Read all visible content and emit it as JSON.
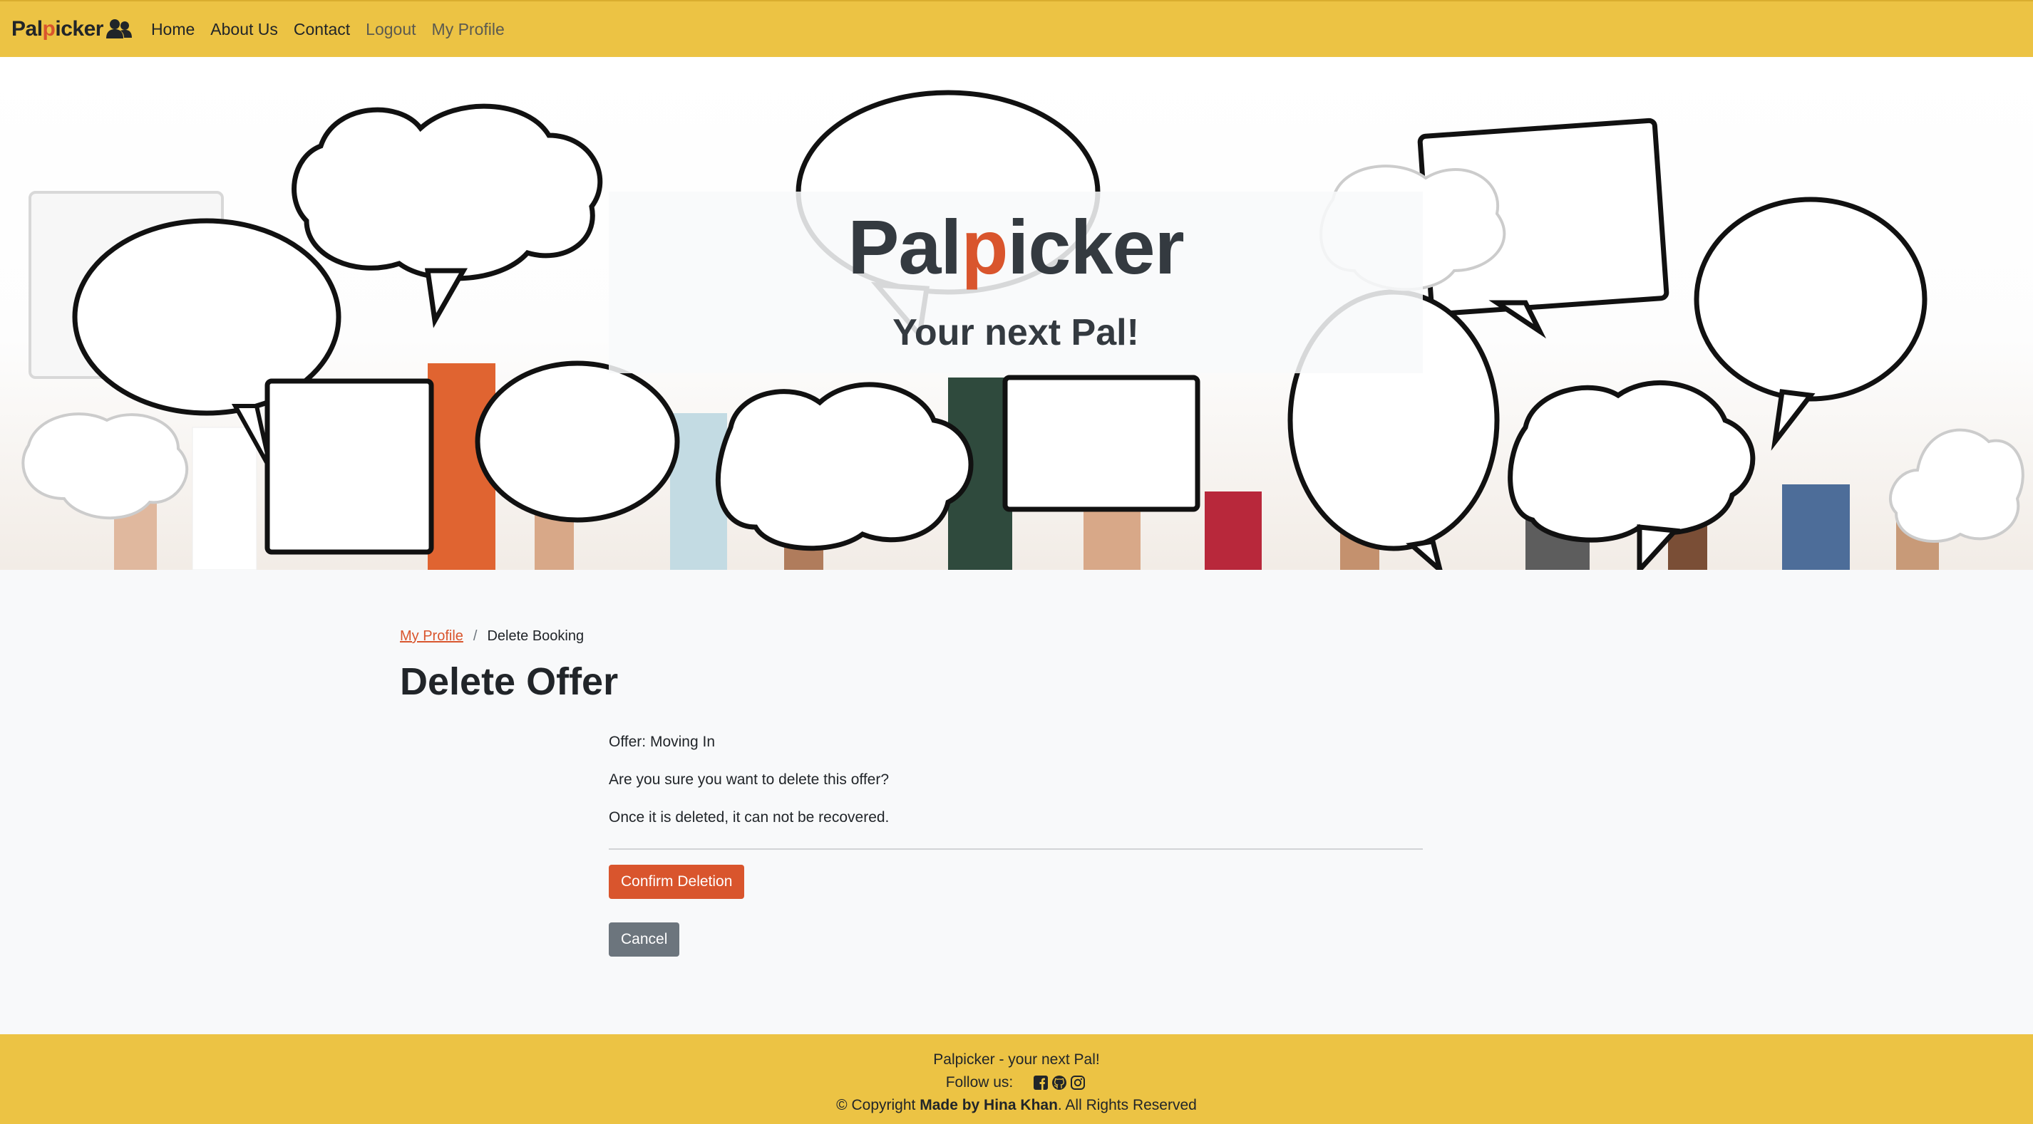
{
  "brand": {
    "name_prefix": "Pal",
    "name_accent": "p",
    "name_suffix": "icker",
    "logo_icon": "users-icon",
    "accent_color": "#d9552d",
    "bar_color": "#ecc344"
  },
  "nav": {
    "items": [
      {
        "label": "Home"
      },
      {
        "label": "About Us"
      },
      {
        "label": "Contact"
      },
      {
        "label": "Logout"
      },
      {
        "label": "My Profile"
      }
    ]
  },
  "hero": {
    "title_prefix": "Pal",
    "title_accent": "p",
    "title_suffix": "icker",
    "subtitle": "Your next Pal!"
  },
  "breadcrumb": {
    "link_label": "My Profile",
    "separator": "/",
    "current": "Delete Booking"
  },
  "page": {
    "title": "Delete Offer",
    "offer_line": "Offer: Moving In",
    "question": "Are you sure you want to delete this offer?",
    "warning": "Once it is deleted, it can not be recovered."
  },
  "actions": {
    "confirm_label": "Confirm Deletion",
    "confirm_color": "#d9552d",
    "cancel_label": "Cancel",
    "cancel_color": "#6c757d"
  },
  "footer": {
    "tagline": "Palpicker - your next Pal!",
    "follow_label": "Follow us:",
    "social_icons": [
      "facebook-icon",
      "github-icon",
      "instagram-icon"
    ],
    "copyright_prefix": "© Copyright ",
    "copyright_strong": "Made by Hina Khan",
    "copyright_suffix": ". All Rights Reserved"
  }
}
